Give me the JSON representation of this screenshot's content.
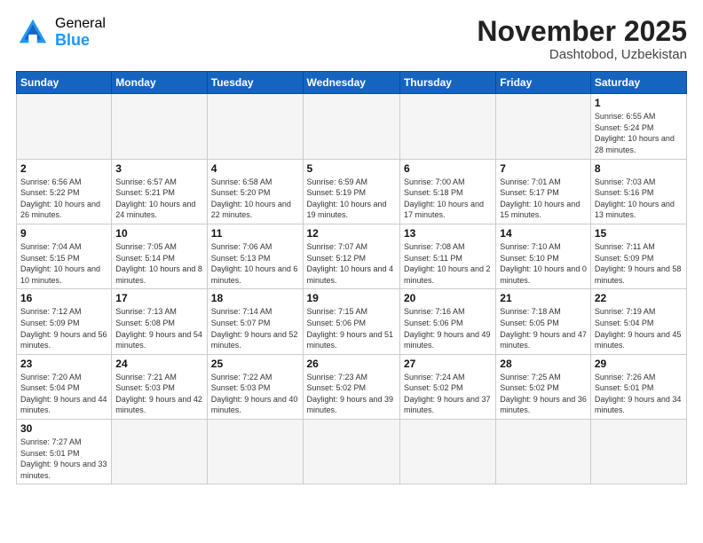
{
  "logo": {
    "general": "General",
    "blue": "Blue"
  },
  "header": {
    "month": "November 2025",
    "location": "Dashtobod, Uzbekistan"
  },
  "days_of_week": [
    "Sunday",
    "Monday",
    "Tuesday",
    "Wednesday",
    "Thursday",
    "Friday",
    "Saturday"
  ],
  "weeks": [
    [
      {
        "day": "",
        "info": ""
      },
      {
        "day": "",
        "info": ""
      },
      {
        "day": "",
        "info": ""
      },
      {
        "day": "",
        "info": ""
      },
      {
        "day": "",
        "info": ""
      },
      {
        "day": "",
        "info": ""
      },
      {
        "day": "1",
        "info": "Sunrise: 6:55 AM\nSunset: 5:24 PM\nDaylight: 10 hours\nand 28 minutes."
      }
    ],
    [
      {
        "day": "2",
        "info": "Sunrise: 6:56 AM\nSunset: 5:22 PM\nDaylight: 10 hours\nand 26 minutes."
      },
      {
        "day": "3",
        "info": "Sunrise: 6:57 AM\nSunset: 5:21 PM\nDaylight: 10 hours\nand 24 minutes."
      },
      {
        "day": "4",
        "info": "Sunrise: 6:58 AM\nSunset: 5:20 PM\nDaylight: 10 hours\nand 22 minutes."
      },
      {
        "day": "5",
        "info": "Sunrise: 6:59 AM\nSunset: 5:19 PM\nDaylight: 10 hours\nand 19 minutes."
      },
      {
        "day": "6",
        "info": "Sunrise: 7:00 AM\nSunset: 5:18 PM\nDaylight: 10 hours\nand 17 minutes."
      },
      {
        "day": "7",
        "info": "Sunrise: 7:01 AM\nSunset: 5:17 PM\nDaylight: 10 hours\nand 15 minutes."
      },
      {
        "day": "8",
        "info": "Sunrise: 7:03 AM\nSunset: 5:16 PM\nDaylight: 10 hours\nand 13 minutes."
      }
    ],
    [
      {
        "day": "9",
        "info": "Sunrise: 7:04 AM\nSunset: 5:15 PM\nDaylight: 10 hours\nand 10 minutes."
      },
      {
        "day": "10",
        "info": "Sunrise: 7:05 AM\nSunset: 5:14 PM\nDaylight: 10 hours\nand 8 minutes."
      },
      {
        "day": "11",
        "info": "Sunrise: 7:06 AM\nSunset: 5:13 PM\nDaylight: 10 hours\nand 6 minutes."
      },
      {
        "day": "12",
        "info": "Sunrise: 7:07 AM\nSunset: 5:12 PM\nDaylight: 10 hours\nand 4 minutes."
      },
      {
        "day": "13",
        "info": "Sunrise: 7:08 AM\nSunset: 5:11 PM\nDaylight: 10 hours\nand 2 minutes."
      },
      {
        "day": "14",
        "info": "Sunrise: 7:10 AM\nSunset: 5:10 PM\nDaylight: 10 hours\nand 0 minutes."
      },
      {
        "day": "15",
        "info": "Sunrise: 7:11 AM\nSunset: 5:09 PM\nDaylight: 9 hours\nand 58 minutes."
      }
    ],
    [
      {
        "day": "16",
        "info": "Sunrise: 7:12 AM\nSunset: 5:09 PM\nDaylight: 9 hours\nand 56 minutes."
      },
      {
        "day": "17",
        "info": "Sunrise: 7:13 AM\nSunset: 5:08 PM\nDaylight: 9 hours\nand 54 minutes."
      },
      {
        "day": "18",
        "info": "Sunrise: 7:14 AM\nSunset: 5:07 PM\nDaylight: 9 hours\nand 52 minutes."
      },
      {
        "day": "19",
        "info": "Sunrise: 7:15 AM\nSunset: 5:06 PM\nDaylight: 9 hours\nand 51 minutes."
      },
      {
        "day": "20",
        "info": "Sunrise: 7:16 AM\nSunset: 5:06 PM\nDaylight: 9 hours\nand 49 minutes."
      },
      {
        "day": "21",
        "info": "Sunrise: 7:18 AM\nSunset: 5:05 PM\nDaylight: 9 hours\nand 47 minutes."
      },
      {
        "day": "22",
        "info": "Sunrise: 7:19 AM\nSunset: 5:04 PM\nDaylight: 9 hours\nand 45 minutes."
      }
    ],
    [
      {
        "day": "23",
        "info": "Sunrise: 7:20 AM\nSunset: 5:04 PM\nDaylight: 9 hours\nand 44 minutes."
      },
      {
        "day": "24",
        "info": "Sunrise: 7:21 AM\nSunset: 5:03 PM\nDaylight: 9 hours\nand 42 minutes."
      },
      {
        "day": "25",
        "info": "Sunrise: 7:22 AM\nSunset: 5:03 PM\nDaylight: 9 hours\nand 40 minutes."
      },
      {
        "day": "26",
        "info": "Sunrise: 7:23 AM\nSunset: 5:02 PM\nDaylight: 9 hours\nand 39 minutes."
      },
      {
        "day": "27",
        "info": "Sunrise: 7:24 AM\nSunset: 5:02 PM\nDaylight: 9 hours\nand 37 minutes."
      },
      {
        "day": "28",
        "info": "Sunrise: 7:25 AM\nSunset: 5:02 PM\nDaylight: 9 hours\nand 36 minutes."
      },
      {
        "day": "29",
        "info": "Sunrise: 7:26 AM\nSunset: 5:01 PM\nDaylight: 9 hours\nand 34 minutes."
      }
    ],
    [
      {
        "day": "30",
        "info": "Sunrise: 7:27 AM\nSunset: 5:01 PM\nDaylight: 9 hours\nand 33 minutes."
      },
      {
        "day": "",
        "info": ""
      },
      {
        "day": "",
        "info": ""
      },
      {
        "day": "",
        "info": ""
      },
      {
        "day": "",
        "info": ""
      },
      {
        "day": "",
        "info": ""
      },
      {
        "day": "",
        "info": ""
      }
    ]
  ]
}
